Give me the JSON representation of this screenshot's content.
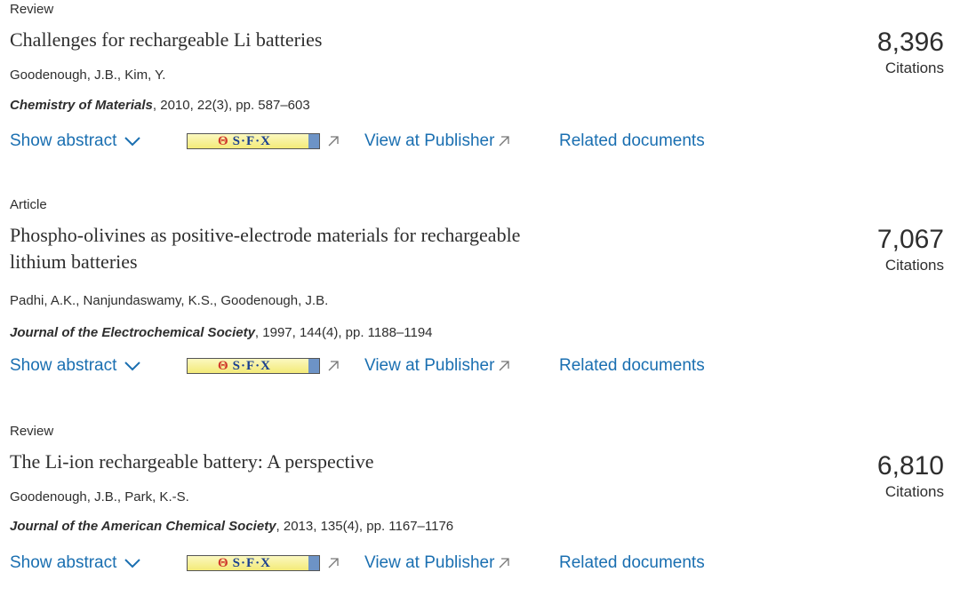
{
  "results": [
    {
      "doc_type": "Review",
      "title_lines": [
        "Challenges for rechargeable Li batteries"
      ],
      "authors": "Goodenough, J.B., Kim, Y.",
      "journal": "Chemistry of Materials",
      "source_rest": ", 2010, 22(3), pp. 587–603",
      "citations": "8,396",
      "citations_label": "Citations"
    },
    {
      "doc_type": "Article",
      "title_lines": [
        "Phospho-olivines as positive-electrode materials for rechargeable",
        "lithium batteries"
      ],
      "authors": "Padhi, A.K., Nanjundaswamy, K.S., Goodenough, J.B.",
      "journal": "Journal of the Electrochemical Society",
      "source_rest": ", 1997, 144(4), pp. 1188–1194",
      "citations": "7,067",
      "citations_label": "Citations"
    },
    {
      "doc_type": "Review",
      "title_lines": [
        "The Li-ion rechargeable battery: A perspective"
      ],
      "authors": "Goodenough, J.B., Park, K.-S.",
      "journal": "Journal of the American Chemical Society",
      "source_rest": ", 2013, 135(4), pp. 1167–1176",
      "citations": "6,810",
      "citations_label": "Citations"
    }
  ],
  "actions": {
    "show_abstract": "Show abstract",
    "sfx_label": "S·F·X",
    "view_at_publisher": "View at Publisher",
    "related_documents": "Related documents"
  },
  "colors": {
    "link": "#1a6fb1",
    "text": "#2e2e2e"
  },
  "icons": {
    "chevron": "chevron-down-icon",
    "external": "external-link-icon",
    "sfx": "sfx-logo-icon"
  }
}
